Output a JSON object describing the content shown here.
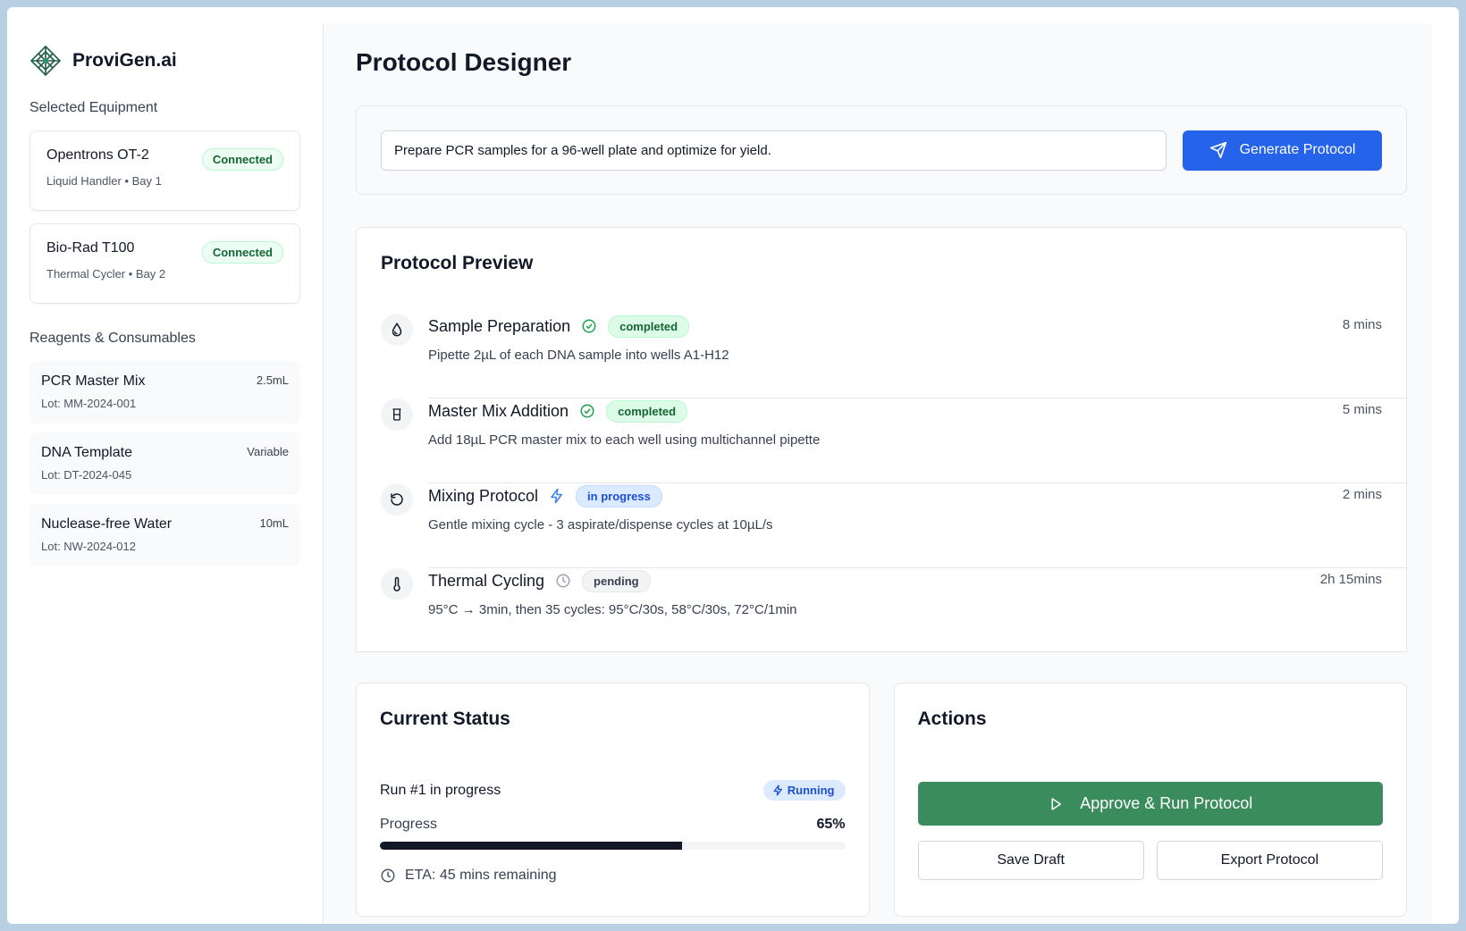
{
  "brand": {
    "name": "ProviGen.ai"
  },
  "sidebar": {
    "equipment_title": "Selected Equipment",
    "equipment": [
      {
        "name": "Opentrons OT-2",
        "subtitle": "Liquid Handler • Bay 1",
        "status": "Connected"
      },
      {
        "name": "Bio-Rad T100",
        "subtitle": "Thermal Cycler • Bay 2",
        "status": "Connected"
      }
    ],
    "reagents_title": "Reagents & Consumables",
    "reagents": [
      {
        "name": "PCR Master Mix",
        "lot": "Lot: MM-2024-001",
        "quantity": "2.5mL"
      },
      {
        "name": "DNA Template",
        "lot": "Lot: DT-2024-045",
        "quantity": "Variable"
      },
      {
        "name": "Nuclease-free Water",
        "lot": "Lot: NW-2024-012",
        "quantity": "10mL"
      }
    ]
  },
  "main": {
    "title": "Protocol Designer",
    "prompt": {
      "value": "Prepare PCR samples for a 96-well plate and optimize for yield.",
      "button_label": "Generate Protocol"
    },
    "preview": {
      "title": "Protocol Preview",
      "steps": [
        {
          "name": "Sample Preparation",
          "status": "completed",
          "description": "Pipette 2µL of each DNA sample into wells A1-H12",
          "duration": "8 mins",
          "icon": "droplet-icon"
        },
        {
          "name": "Master Mix Addition",
          "status": "completed",
          "description": "Add 18µL PCR master mix to each well using multichannel pipette",
          "duration": "5 mins",
          "icon": "beaker-icon"
        },
        {
          "name": "Mixing Protocol",
          "status": "in progress",
          "description": "Gentle mixing cycle - 3 aspirate/dispense cycles at 10µL/s",
          "duration": "2 mins",
          "icon": "rotate-icon"
        },
        {
          "name": "Thermal Cycling",
          "status": "pending",
          "description": "95°C → 3min, then 35 cycles: 95°C/30s, 58°C/30s, 72°C/1min",
          "duration": "2h 15mins",
          "icon": "thermometer-icon"
        }
      ]
    },
    "status": {
      "title": "Current Status",
      "run_text": "Run #1 in progress",
      "run_badge": "Running",
      "progress_label": "Progress",
      "progress_value": "65%",
      "progress_fraction": 0.65,
      "eta": "ETA: 45 mins remaining"
    },
    "actions": {
      "title": "Actions",
      "approve_label": "Approve & Run Protocol",
      "save_label": "Save Draft",
      "export_label": "Export Protocol"
    }
  },
  "colors": {
    "primary": "#2563eb",
    "approve": "#3a8c5c",
    "completed": "#166534",
    "in_progress": "#1d4ed8"
  }
}
